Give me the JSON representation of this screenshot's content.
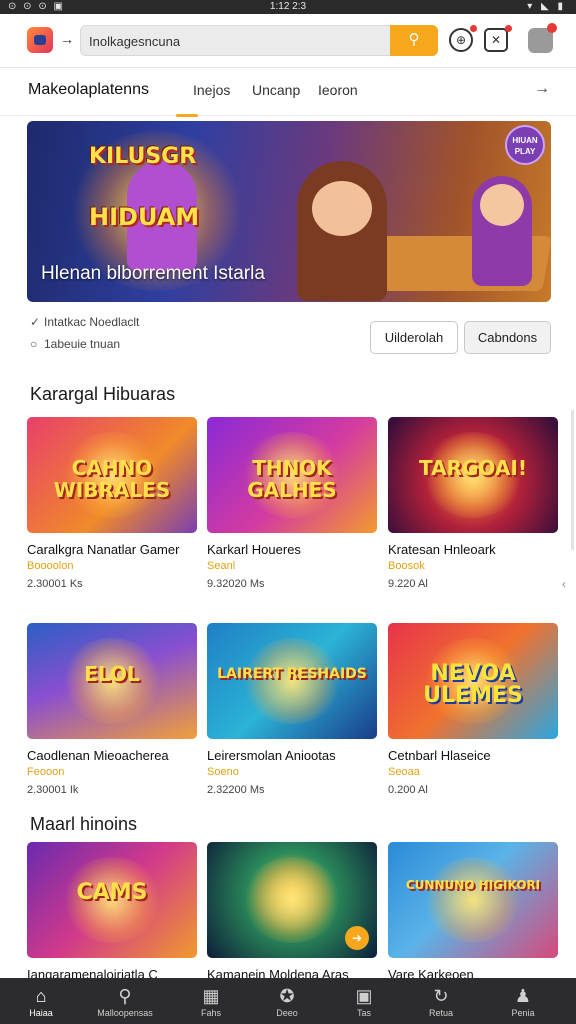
{
  "status_bar": {
    "left_icons": "⊙ ⊙ ⊙ ▣",
    "time": "1:12 2:3",
    "right_icons": "▾ ◣ ▮"
  },
  "header": {
    "search": {
      "value": "Inolkagesncuna",
      "placeholder": "Inolkagesncuna"
    },
    "icons": [
      "app-logo",
      "back-arrow-icon",
      "search-icon",
      "notification-icon",
      "gamepad-icon",
      "avatar"
    ]
  },
  "tabs": {
    "title": "Makeolaplatenns",
    "items": [
      "Inejos",
      "Uncanp",
      "Ieoron"
    ],
    "more": "→"
  },
  "hero": {
    "logo_line1": "KILUSGR",
    "logo_line2": "HIDUAM",
    "badge": "HIUAN PLAY",
    "caption": "Hlenan blborrement Istarla"
  },
  "info": {
    "line1": "Intatkac  Noedlaclt",
    "line2": "1abeuie tnuan",
    "primary_button": "Uilderolah",
    "secondary_button": "Cabndons"
  },
  "sections": {
    "featured_title": "Karargal Hibuaras",
    "more_title": "Maarl hinoins"
  },
  "cards_row1": [
    {
      "thumb_text": "CAHNO WIBRALES",
      "name": "Caralkgra Nanatlar Gamer",
      "tag": "Boooolon",
      "stats": "2.30001 Ks"
    },
    {
      "thumb_text": "THNOK GALHES",
      "name": "Karkarl Houeres",
      "tag": "Seanl",
      "stats": "9.32020 Ms"
    },
    {
      "thumb_text": "TARGOAI!",
      "name": "Kratesan Hnleoark",
      "tag": "Boosok",
      "stats": "9.220 Al"
    }
  ],
  "cards_row2": [
    {
      "thumb_text": "ELOL",
      "name": "Caodlenan Mieoacherea",
      "tag": "Feooon",
      "stats": "2.30001 Ik"
    },
    {
      "thumb_text": "LAIRERT RESHAIDS",
      "name": "Leirersmolan Aniootas",
      "tag": "Soeno",
      "stats": "2.32200 Ms"
    },
    {
      "thumb_text": "NEVOA ULEMES",
      "name": "Cetnbarl Hlaseice",
      "tag": "Seoaa",
      "stats": "0.200 Al"
    }
  ],
  "cards_row3": [
    {
      "thumb_text": "CAMS",
      "name": "Iangaramenaloiriatla C"
    },
    {
      "thumb_text": "",
      "name": "Kamanein Moldena Aras"
    },
    {
      "thumb_text": "CUNNUNO HIGIKORI",
      "name": "Vare Karkeoen"
    }
  ],
  "side_arrow": "‹",
  "bottom_nav": [
    {
      "icon": "home-icon",
      "glyph": "⌂",
      "label": "Haiaa"
    },
    {
      "icon": "search-icon",
      "glyph": "⚲",
      "label": "Malloopensas"
    },
    {
      "icon": "grid-icon",
      "glyph": "▦",
      "label": "Fahs"
    },
    {
      "icon": "gamepad-icon",
      "glyph": "✪",
      "label": "Deeo"
    },
    {
      "icon": "image-icon",
      "glyph": "▣",
      "label": "Tas"
    },
    {
      "icon": "refresh-icon",
      "glyph": "↻",
      "label": "Retua"
    },
    {
      "icon": "profile-icon",
      "glyph": "♟",
      "label": "Penia"
    }
  ],
  "colors": {
    "accent": "#f6a71b",
    "tag": "#e0a213",
    "nav_bg": "#2c2c2e",
    "notification": "#e53935"
  }
}
